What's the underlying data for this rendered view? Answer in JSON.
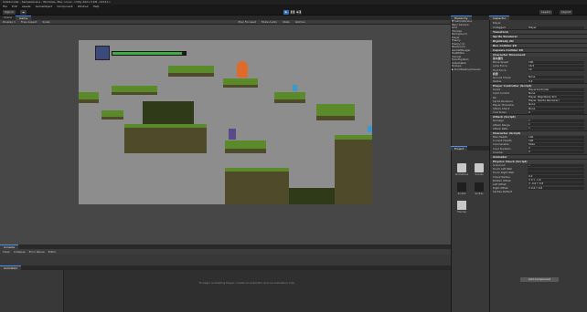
{
  "window": {
    "title": "SideScroller - SampleScene - Windows, Mac, Linux - Unity 2021.3.6f1 <DX11>"
  },
  "menu": [
    "File",
    "Edit",
    "Assets",
    "GameObject",
    "Component",
    "Window",
    "Help"
  ],
  "toolbar": {
    "account": "Sign in",
    "cloud": "☁",
    "layers": "Layers",
    "layout": "Layout"
  },
  "scene_tabs": [
    "Scene",
    "Game"
  ],
  "game_toolbar": {
    "display": "Display 1",
    "aspect": "Free Aspect",
    "scale": "Scale",
    "play_mode": "Play Focused",
    "mute": "Mute Audio",
    "stats": "Stats",
    "gizmos": "Gizmos"
  },
  "console_tabs": [
    "Console"
  ],
  "console_toolbar": [
    "Clear",
    "Collapse",
    "Error Pause",
    "Editor"
  ],
  "anim_tabs": [
    "Animation"
  ],
  "anim_message": "To begin animating Player, create an Animator and an Animation Clip.",
  "hierarchy": {
    "tab": "Hierarchy",
    "rows": [
      "▼ SampleScene",
      "  Main Camera",
      "  Grid",
      "    Tilemap",
      "    Background",
      "  Player",
      "  Enemy",
      "  Enemy (1)",
      "  Mushroom",
      "  GameManager",
      "  HealthBar",
      "  Canvas",
      "  EventSystem",
      "  Collectable",
      "  Pickups",
      "▶ DontDestroyOnLoad"
    ]
  },
  "project": {
    "tab": "Project",
    "assets": [
      "Animations",
      "Scenes",
      "Scripts",
      "Sprites",
      "Tilemap",
      "Player"
    ]
  },
  "inspector": {
    "tab": "Inspector",
    "object_name": "Player",
    "tag": "Untagged",
    "layer": "Player",
    "components": [
      {
        "name": "Transform"
      },
      {
        "name": "Sprite Renderer"
      },
      {
        "name": "Rigidbody 2D"
      },
      {
        "name": "Box Collider 2D"
      },
      {
        "name": "Capsule Collider 2D"
      },
      {
        "name": "Character Movement"
      }
    ],
    "section1_title": "基本属性",
    "props1": [
      {
        "label": "Move Speed",
        "value": "100"
      },
      {
        "label": "Jump Force",
        "value": "16.5"
      },
      {
        "label": "Hurt Force",
        "value": "10"
      }
    ],
    "section2_title": "检测",
    "props2": [
      {
        "label": "Ground Check",
        "value": "None"
      },
      {
        "label": "Radius",
        "value": "0.2"
      }
    ],
    "script_header": "Player Controller (Script)",
    "props3": [
      {
        "label": "Script",
        "value": "PlayerController"
      },
      {
        "label": "Input Control",
        "value": "None"
      },
      {
        "label": "Rb",
        "value": "Player (Rigidbody 2D)"
      },
      {
        "label": "Sprite Renderer",
        "value": "Player (Sprite Renderer)"
      },
      {
        "label": "Player Character",
        "value": "None"
      },
      {
        "label": "Attack Check",
        "value": "None"
      },
      {
        "label": "Cool Down",
        "value": "0"
      }
    ],
    "attack_header": "Attack (Script)",
    "props4": [
      {
        "label": "Damage",
        "value": "1"
      },
      {
        "label": "Attack Range",
        "value": "1"
      },
      {
        "label": "Attack Rate",
        "value": "1"
      }
    ],
    "char_header": "Character (Script)",
    "props5": [
      {
        "label": "Max Health",
        "value": "100"
      },
      {
        "label": "Current Health",
        "value": "100"
      },
      {
        "label": "Invulnerable",
        "value": "False"
      },
      {
        "label": "Invul Duration",
        "value": "2"
      },
      {
        "label": "Counter",
        "value": "0"
      }
    ],
    "anim_header": "Animator",
    "phys_header": "Physics Check (Script)",
    "props6": [
      {
        "label": "Is Ground",
        "value": "✓"
      },
      {
        "label": "Touch Left Wall",
        "value": ""
      },
      {
        "label": "Touch Right Wall",
        "value": ""
      },
      {
        "label": "Check Radius",
        "value": "0.2"
      },
      {
        "label": "Bottom Offset",
        "value": "X 0   Y -1.6"
      },
      {
        "label": "Left Offset",
        "value": "X -0.6  Y 0.8"
      },
      {
        "label": "Right Offset",
        "value": "X 0.6  Y 0.8"
      }
    ],
    "material": "Sprites-Default",
    "add_component": "Add Component"
  },
  "game": {
    "health_fraction": 0.95
  },
  "colors": {
    "accent": "#3c6fb3",
    "health": "#3fae3f",
    "grass": "#5a8a2a",
    "rock": "#4e4a2a",
    "sky": "#8d8d8d"
  }
}
